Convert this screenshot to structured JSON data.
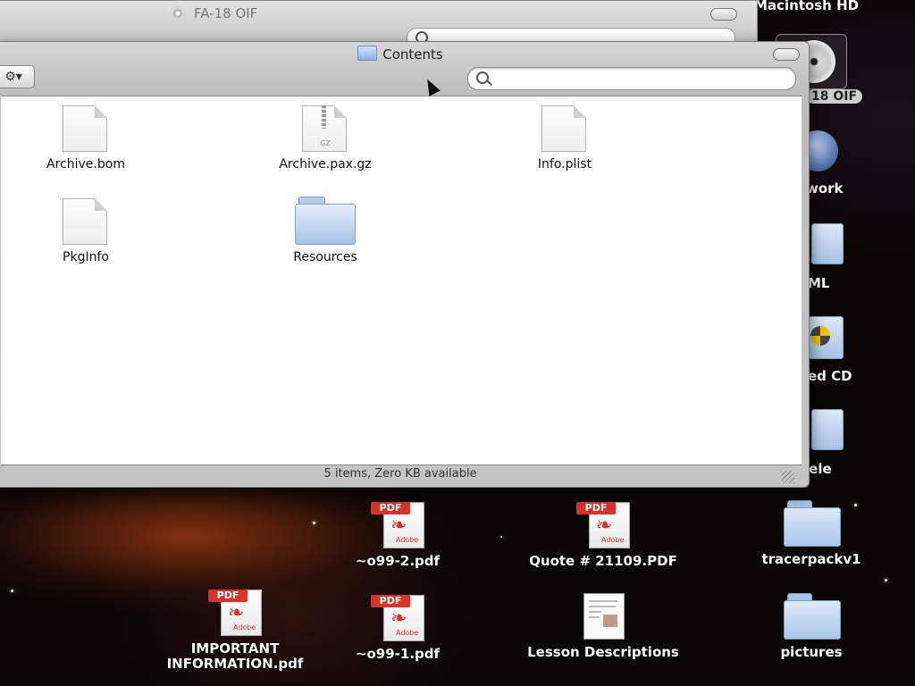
{
  "back_window": {
    "title": "FA-18 OIF"
  },
  "window": {
    "title": "Contents",
    "action_button": "⚙▾",
    "search": {
      "value": "",
      "placeholder": ""
    },
    "items": [
      {
        "name": "Archive.bom",
        "kind": "document"
      },
      {
        "name": "Archive.pax.gz",
        "kind": "archive",
        "badge": "GZ"
      },
      {
        "name": "Info.plist",
        "kind": "document"
      },
      {
        "name": "PkgInfo",
        "kind": "document"
      },
      {
        "name": "Resources",
        "kind": "folder"
      }
    ],
    "status": "5 items, Zero KB available"
  },
  "desktop": {
    "right_labels": [
      "Macintosh HD",
      "18 OIF",
      "work",
      "ML",
      "ed CD",
      "lele"
    ],
    "icons": [
      {
        "label": "~o99-2.pdf",
        "kind": "pdf"
      },
      {
        "label": "Quote # 21109.PDF",
        "kind": "pdf"
      },
      {
        "label": "tracerpackv1",
        "kind": "folder"
      },
      {
        "label": "IMPORTANT\nINFORMATION.pdf",
        "kind": "pdf"
      },
      {
        "label": "~o99-1.pdf",
        "kind": "pdf"
      },
      {
        "label": "Lesson Descriptions",
        "kind": "document"
      },
      {
        "label": "pictures",
        "kind": "folder"
      }
    ],
    "pdf_tag": "PDF",
    "pdf_brand": "Adobe"
  }
}
